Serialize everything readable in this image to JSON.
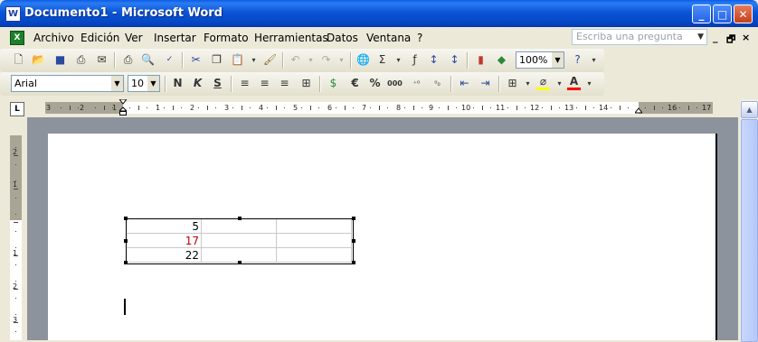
{
  "window": {
    "title": "Documento1 - Microsoft Word",
    "icon_label": "W",
    "minimize": "_",
    "maximize": "□",
    "close": "✕"
  },
  "menu": {
    "icon_label": "X",
    "items": [
      "Archivo",
      "Edición",
      "Ver",
      "Insertar",
      "Formato",
      "Herramientas",
      "Datos",
      "Ventana",
      "?"
    ],
    "help_placeholder": "Escriba una pregunta",
    "doc_controls": [
      "_",
      "🗗",
      "×"
    ]
  },
  "toolbar_standard": {
    "zoom": "100%"
  },
  "toolbar_format": {
    "font": "Arial",
    "size": "10",
    "bold": "N",
    "italic": "K",
    "underline": "S",
    "euro": "€",
    "percent": "%",
    "thousands": "000"
  },
  "ruler": {
    "h_numbers": [
      "3",
      "2",
      "1",
      "1",
      "2",
      "3",
      "4",
      "5",
      "6",
      "7",
      "8",
      "9",
      "10",
      "11",
      "12",
      "13",
      "14",
      "16",
      "17"
    ],
    "v_numbers": [
      "2",
      "1",
      "1",
      "2",
      "3"
    ]
  },
  "table": {
    "rows": [
      [
        "5",
        "",
        ""
      ],
      [
        "17",
        "",
        ""
      ],
      [
        "22",
        "",
        ""
      ]
    ]
  },
  "colors": {
    "title_blue": "#0a55d6",
    "cell_red": "#c00000",
    "font_color_bar": "#ff0000",
    "highlight_bar": "#ffff00"
  }
}
